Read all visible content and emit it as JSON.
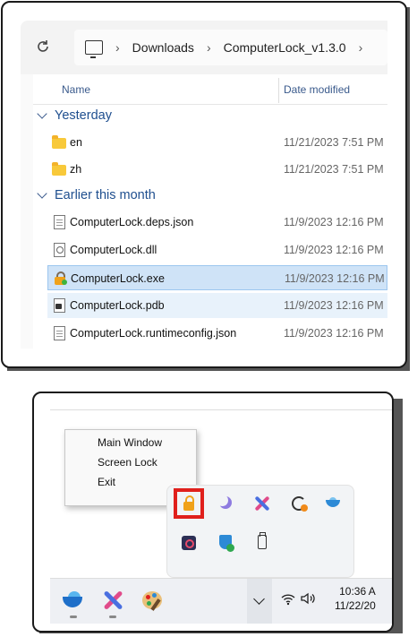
{
  "explorer": {
    "breadcrumb": [
      "Downloads",
      "ComputerLock_v1.3.0"
    ],
    "columns": {
      "name": "Name",
      "date": "Date modified"
    },
    "groups": [
      {
        "title": "Yesterday"
      },
      {
        "title": "Earlier this month"
      }
    ],
    "rows": [
      {
        "name": "en",
        "date": "11/21/2023 7:51 PM",
        "icon": "folder-icon"
      },
      {
        "name": "zh",
        "date": "11/21/2023 7:51 PM",
        "icon": "folder-icon"
      },
      {
        "name": "ComputerLock.deps.json",
        "date": "11/9/2023 12:16 PM",
        "icon": "json-file-icon"
      },
      {
        "name": "ComputerLock.dll",
        "date": "11/9/2023 12:16 PM",
        "icon": "dll-file-icon"
      },
      {
        "name": "ComputerLock.exe",
        "date": "11/9/2023 12:16 PM",
        "icon": "lock-app-icon",
        "state": "selected"
      },
      {
        "name": "ComputerLock.pdb",
        "date": "11/9/2023 12:16 PM",
        "icon": "pdb-file-icon",
        "state": "hover"
      },
      {
        "name": "ComputerLock.runtimeconfig.json",
        "date": "11/9/2023 12:16 PM",
        "icon": "json-file-icon"
      }
    ]
  },
  "context_menu": {
    "items": [
      "Main Window",
      "Screen Lock",
      "Exit"
    ]
  },
  "tray": {
    "icons": [
      "lock-icon",
      "moon-icon",
      "x-app-icon",
      "sync-icon",
      "bird-icon",
      "gear-app-icon",
      "security-shield-icon",
      "usb-drive-icon"
    ],
    "highlight_color": "#e0201c"
  },
  "taskbar": {
    "apps": [
      "bird-app-icon",
      "x-app-icon",
      "paint-palette-icon"
    ],
    "time": "10:36 A",
    "date": "11/22/20"
  }
}
